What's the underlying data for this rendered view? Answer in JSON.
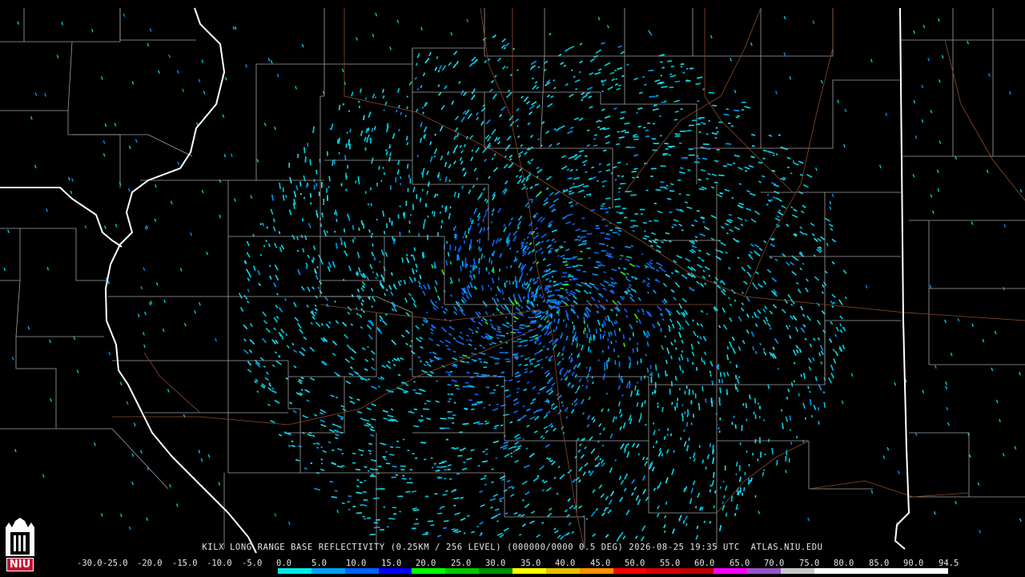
{
  "caption": "KILX LONG RANGE BASE REFLECTIVITY (0.25KM / 256 LEVEL) (000000/0000 0.5 DEG) 2026-08-25 19:35 UTC  ATLAS.NIU.EDU",
  "colorbar": {
    "labels": [
      "-30.0",
      "-25.0",
      "-20.0",
      "-15.0",
      "-10.0",
      "-5.0",
      "0.0",
      "5.0",
      "10.0",
      "15.0",
      "20.0",
      "25.0",
      "30.0",
      "35.0",
      "40.0",
      "45.0",
      "50.0",
      "55.0",
      "60.0",
      "65.0",
      "70.0",
      "75.0",
      "80.0",
      "85.0",
      "90.0",
      "94.5"
    ],
    "colors": [
      "#000000",
      "#000000",
      "#000000",
      "#000000",
      "#000000",
      "#000000",
      "#00e8e8",
      "#00a0f0",
      "#0060ff",
      "#0000ff",
      "#00ff00",
      "#00c800",
      "#009000",
      "#ffff00",
      "#e8c000",
      "#ff9000",
      "#ff0000",
      "#d60000",
      "#c00000",
      "#ff00ff",
      "#9955c8",
      "#c8c8c8",
      "#ffffff",
      "#ffffff",
      "#ffffff",
      "#ffffff"
    ]
  },
  "logo": {
    "text": "NIU",
    "color": "#c8102e"
  },
  "radar": {
    "site": "KILX",
    "echo_colors": [
      "#00c8d8",
      "#0090e8",
      "#1060f0",
      "#20d8e8",
      "#20b060",
      "#40e020"
    ]
  }
}
